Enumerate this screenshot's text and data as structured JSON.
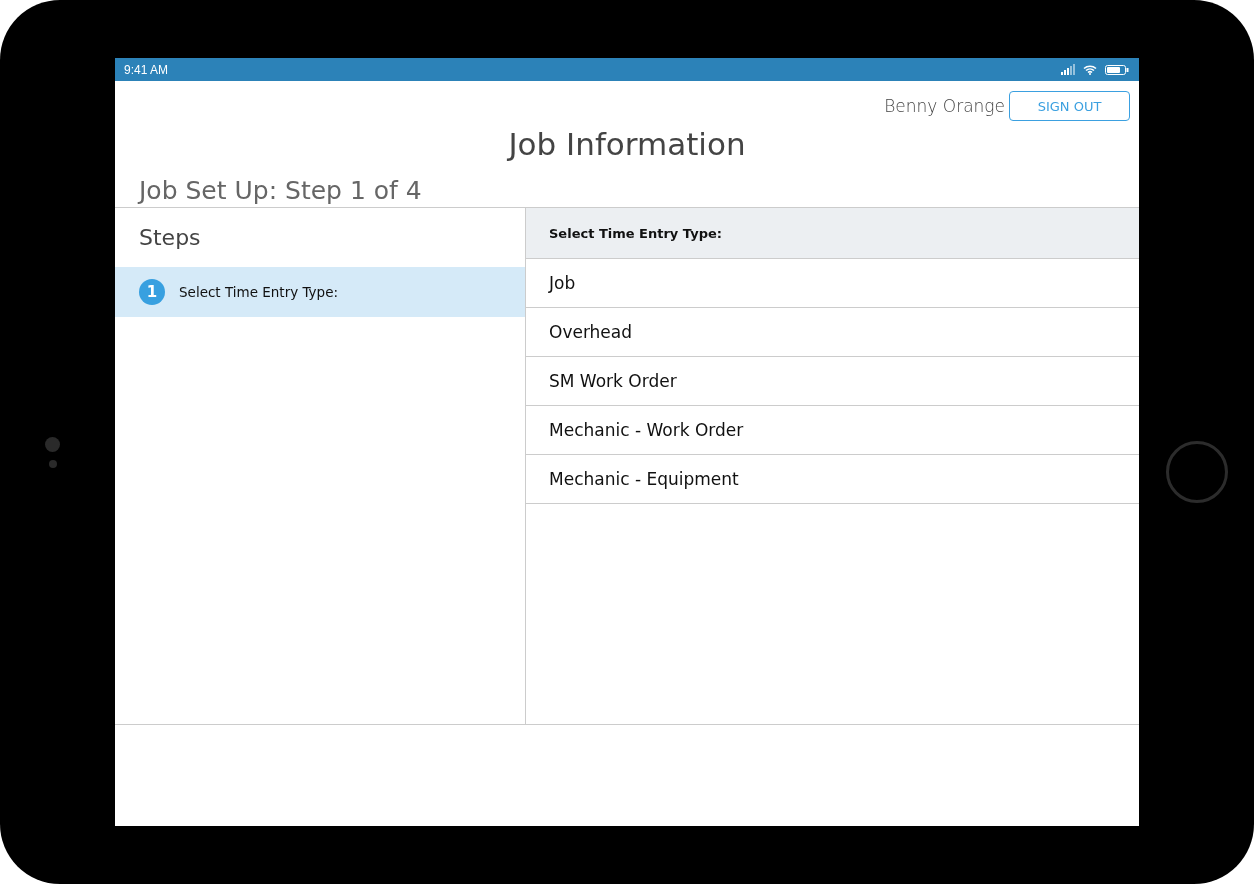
{
  "status_bar": {
    "time": "9:41 AM"
  },
  "header": {
    "user_name": "Benny Orange",
    "sign_out": "SIGN OUT",
    "title": "Job Information",
    "subtitle": "Job Set Up: Step 1 of 4"
  },
  "steps": {
    "title": "Steps",
    "items": [
      {
        "number": "1",
        "label": "Select Time Entry Type:",
        "selected": true
      }
    ]
  },
  "options": {
    "heading": "Select Time Entry Type:",
    "items": [
      {
        "label": "Job"
      },
      {
        "label": "Overhead"
      },
      {
        "label": "SM Work Order"
      },
      {
        "label": "Mechanic - Work Order"
      },
      {
        "label": "Mechanic - Equipment"
      }
    ]
  }
}
